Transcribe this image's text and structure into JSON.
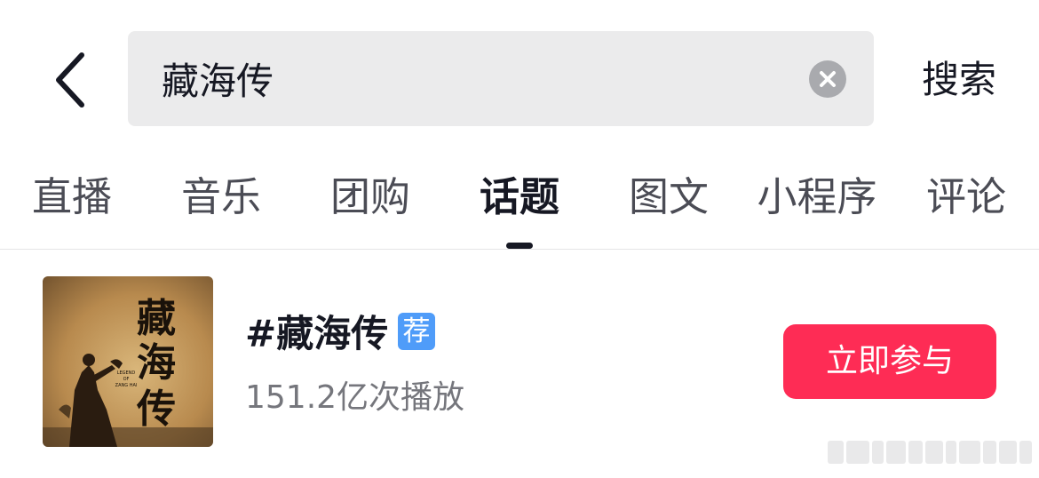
{
  "header": {
    "back_icon": "chevron-left-icon",
    "search_value": "藏海传",
    "clear_icon": "clear-circle-icon",
    "search_button_label": "搜索"
  },
  "tabs": [
    {
      "label": "直播",
      "active": false
    },
    {
      "label": "音乐",
      "active": false
    },
    {
      "label": "团购",
      "active": false
    },
    {
      "label": "话题",
      "active": true
    },
    {
      "label": "图文",
      "active": false
    },
    {
      "label": "小程序",
      "active": false
    },
    {
      "label": "评论",
      "active": false
    }
  ],
  "topic": {
    "title": "#藏海传",
    "badge": "荐",
    "views": "151.2亿次播放",
    "join_label": "立即参与",
    "cover_calligraphy": "藏海传",
    "cover_subtitle": "LEGEND OF ZANG HAI"
  },
  "colors": {
    "accent": "#fe2c55",
    "badge": "#4f9cf9",
    "search_bg": "#ebebec",
    "text_primary": "#161823",
    "text_secondary": "#75767c"
  }
}
